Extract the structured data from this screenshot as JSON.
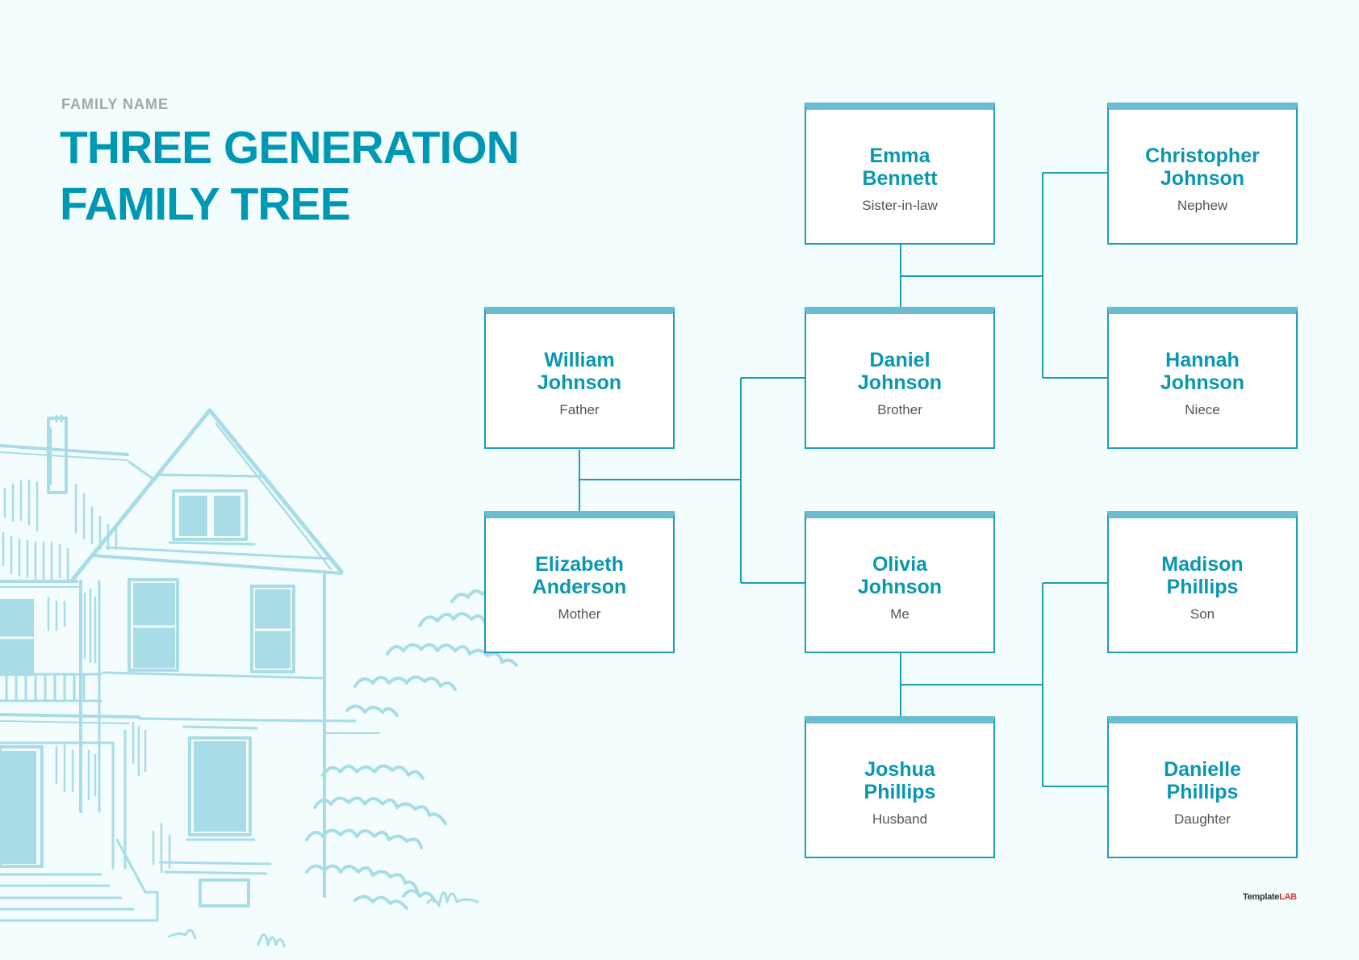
{
  "header": {
    "family_label": "FAMILY NAME",
    "title_line1": "THREE GENERATION",
    "title_line2": "FAMILY TREE"
  },
  "colors": {
    "background": "#f4fdfd",
    "accent": "#0097b2",
    "card_border": "#1e9db7",
    "card_top_bar": "#6dbccf",
    "illustration": "#a8dce6"
  },
  "members": {
    "father": {
      "first": "William",
      "last": "Johnson",
      "role": "Father"
    },
    "mother": {
      "first": "Elizabeth",
      "last": "Anderson",
      "role": "Mother"
    },
    "sister_in_law": {
      "first": "Emma",
      "last": "Bennett",
      "role": "Sister-in-law"
    },
    "brother": {
      "first": "Daniel",
      "last": "Johnson",
      "role": "Brother"
    },
    "me": {
      "first": "Olivia",
      "last": "Johnson",
      "role": "Me"
    },
    "husband": {
      "first": "Joshua",
      "last": "Phillips",
      "role": "Husband"
    },
    "nephew": {
      "first": "Christopher",
      "last": "Johnson",
      "role": "Nephew"
    },
    "niece": {
      "first": "Hannah",
      "last": "Johnson",
      "role": "Niece"
    },
    "son": {
      "first": "Madison",
      "last": "Phillips",
      "role": "Son"
    },
    "daughter": {
      "first": "Danielle",
      "last": "Phillips",
      "role": "Daughter"
    }
  },
  "relationships": [
    {
      "type": "couple",
      "members": [
        "father",
        "mother"
      ]
    },
    {
      "type": "children",
      "parents": [
        "father",
        "mother"
      ],
      "children": [
        "brother",
        "me"
      ]
    },
    {
      "type": "couple",
      "members": [
        "sister_in_law",
        "brother"
      ]
    },
    {
      "type": "children",
      "parents": [
        "sister_in_law",
        "brother"
      ],
      "children": [
        "nephew",
        "niece"
      ]
    },
    {
      "type": "couple",
      "members": [
        "me",
        "husband"
      ]
    },
    {
      "type": "children",
      "parents": [
        "me",
        "husband"
      ],
      "children": [
        "son",
        "daughter"
      ]
    }
  ],
  "brand": {
    "part1": "Template",
    "part2": "LAB"
  }
}
